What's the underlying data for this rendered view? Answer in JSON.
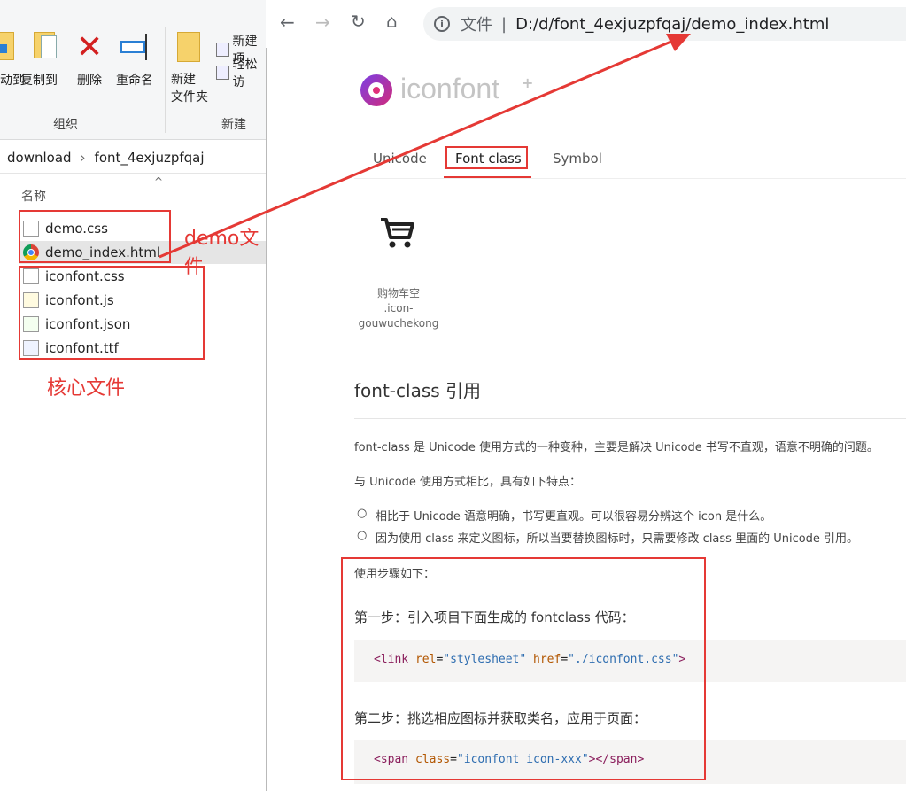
{
  "explorer": {
    "ribbon": {
      "buttons": [
        {
          "label": "动到"
        },
        {
          "label": "复制到"
        },
        {
          "label": "删除"
        },
        {
          "label": "重命名"
        },
        {
          "label": "新建\n文件夹"
        }
      ],
      "small_buttons": [
        "新建项",
        "轻松访"
      ],
      "groups": [
        "组织",
        "新建"
      ]
    },
    "breadcrumb": [
      "download",
      "font_4exjuzpfqaj"
    ],
    "column_header": "名称",
    "files": [
      {
        "name": "demo.css",
        "icon": "css-file-icon"
      },
      {
        "name": "demo_index.html",
        "icon": "chrome-html-icon"
      },
      {
        "name": "iconfont.css",
        "icon": "css-file-icon"
      },
      {
        "name": "iconfont.js",
        "icon": "js-file-icon"
      },
      {
        "name": "iconfont.json",
        "icon": "json-file-icon"
      },
      {
        "name": "iconfont.ttf",
        "icon": "font-file-icon"
      }
    ]
  },
  "annotations": {
    "demo_label": "demo文件",
    "core_label": "核心文件"
  },
  "browser": {
    "url_prefix": "文件",
    "url": "D:/d/font_4exjuzpfqaj/demo_index.html",
    "brand": "iconfont",
    "tabs": [
      "Unicode",
      "Font class",
      "Symbol"
    ],
    "active_tab": "Font class",
    "icon_item": {
      "name": "购物车空",
      "class_line1": ".icon-",
      "class_line2": "gouwuchekong"
    },
    "section_title": "font-class 引用",
    "para1": "font-class 是 Unicode 使用方式的一种变种，主要是解决 Unicode 书写不直观，语意不明确的问题。",
    "para2": "与 Unicode 使用方式相比，具有如下特点：",
    "bullets": [
      "相比于 Unicode 语意明确，书写更直观。可以很容易分辨这个 icon 是什么。",
      "因为使用 class 来定义图标，所以当要替换图标时，只需要修改 class 里面的 Unicode 引用。"
    ],
    "steps_intro": "使用步骤如下：",
    "step1": "第一步：引入项目下面生成的 fontclass 代码：",
    "code1": {
      "tag_open": "<link",
      "attr1": "rel",
      "val1": "\"stylesheet\"",
      "attr2": "href",
      "val2": "\"./iconfont.css\"",
      "tag_close": ">"
    },
    "step2": "第二步：挑选相应图标并获取类名，应用于页面：",
    "code2": {
      "tag_open": "<span",
      "attr1": "class",
      "val1": "\"iconfont icon-xxx\"",
      "tag_close": "></span>"
    }
  },
  "colors": {
    "annotation_red": "#e53935",
    "arrow_red": "#e53935"
  }
}
